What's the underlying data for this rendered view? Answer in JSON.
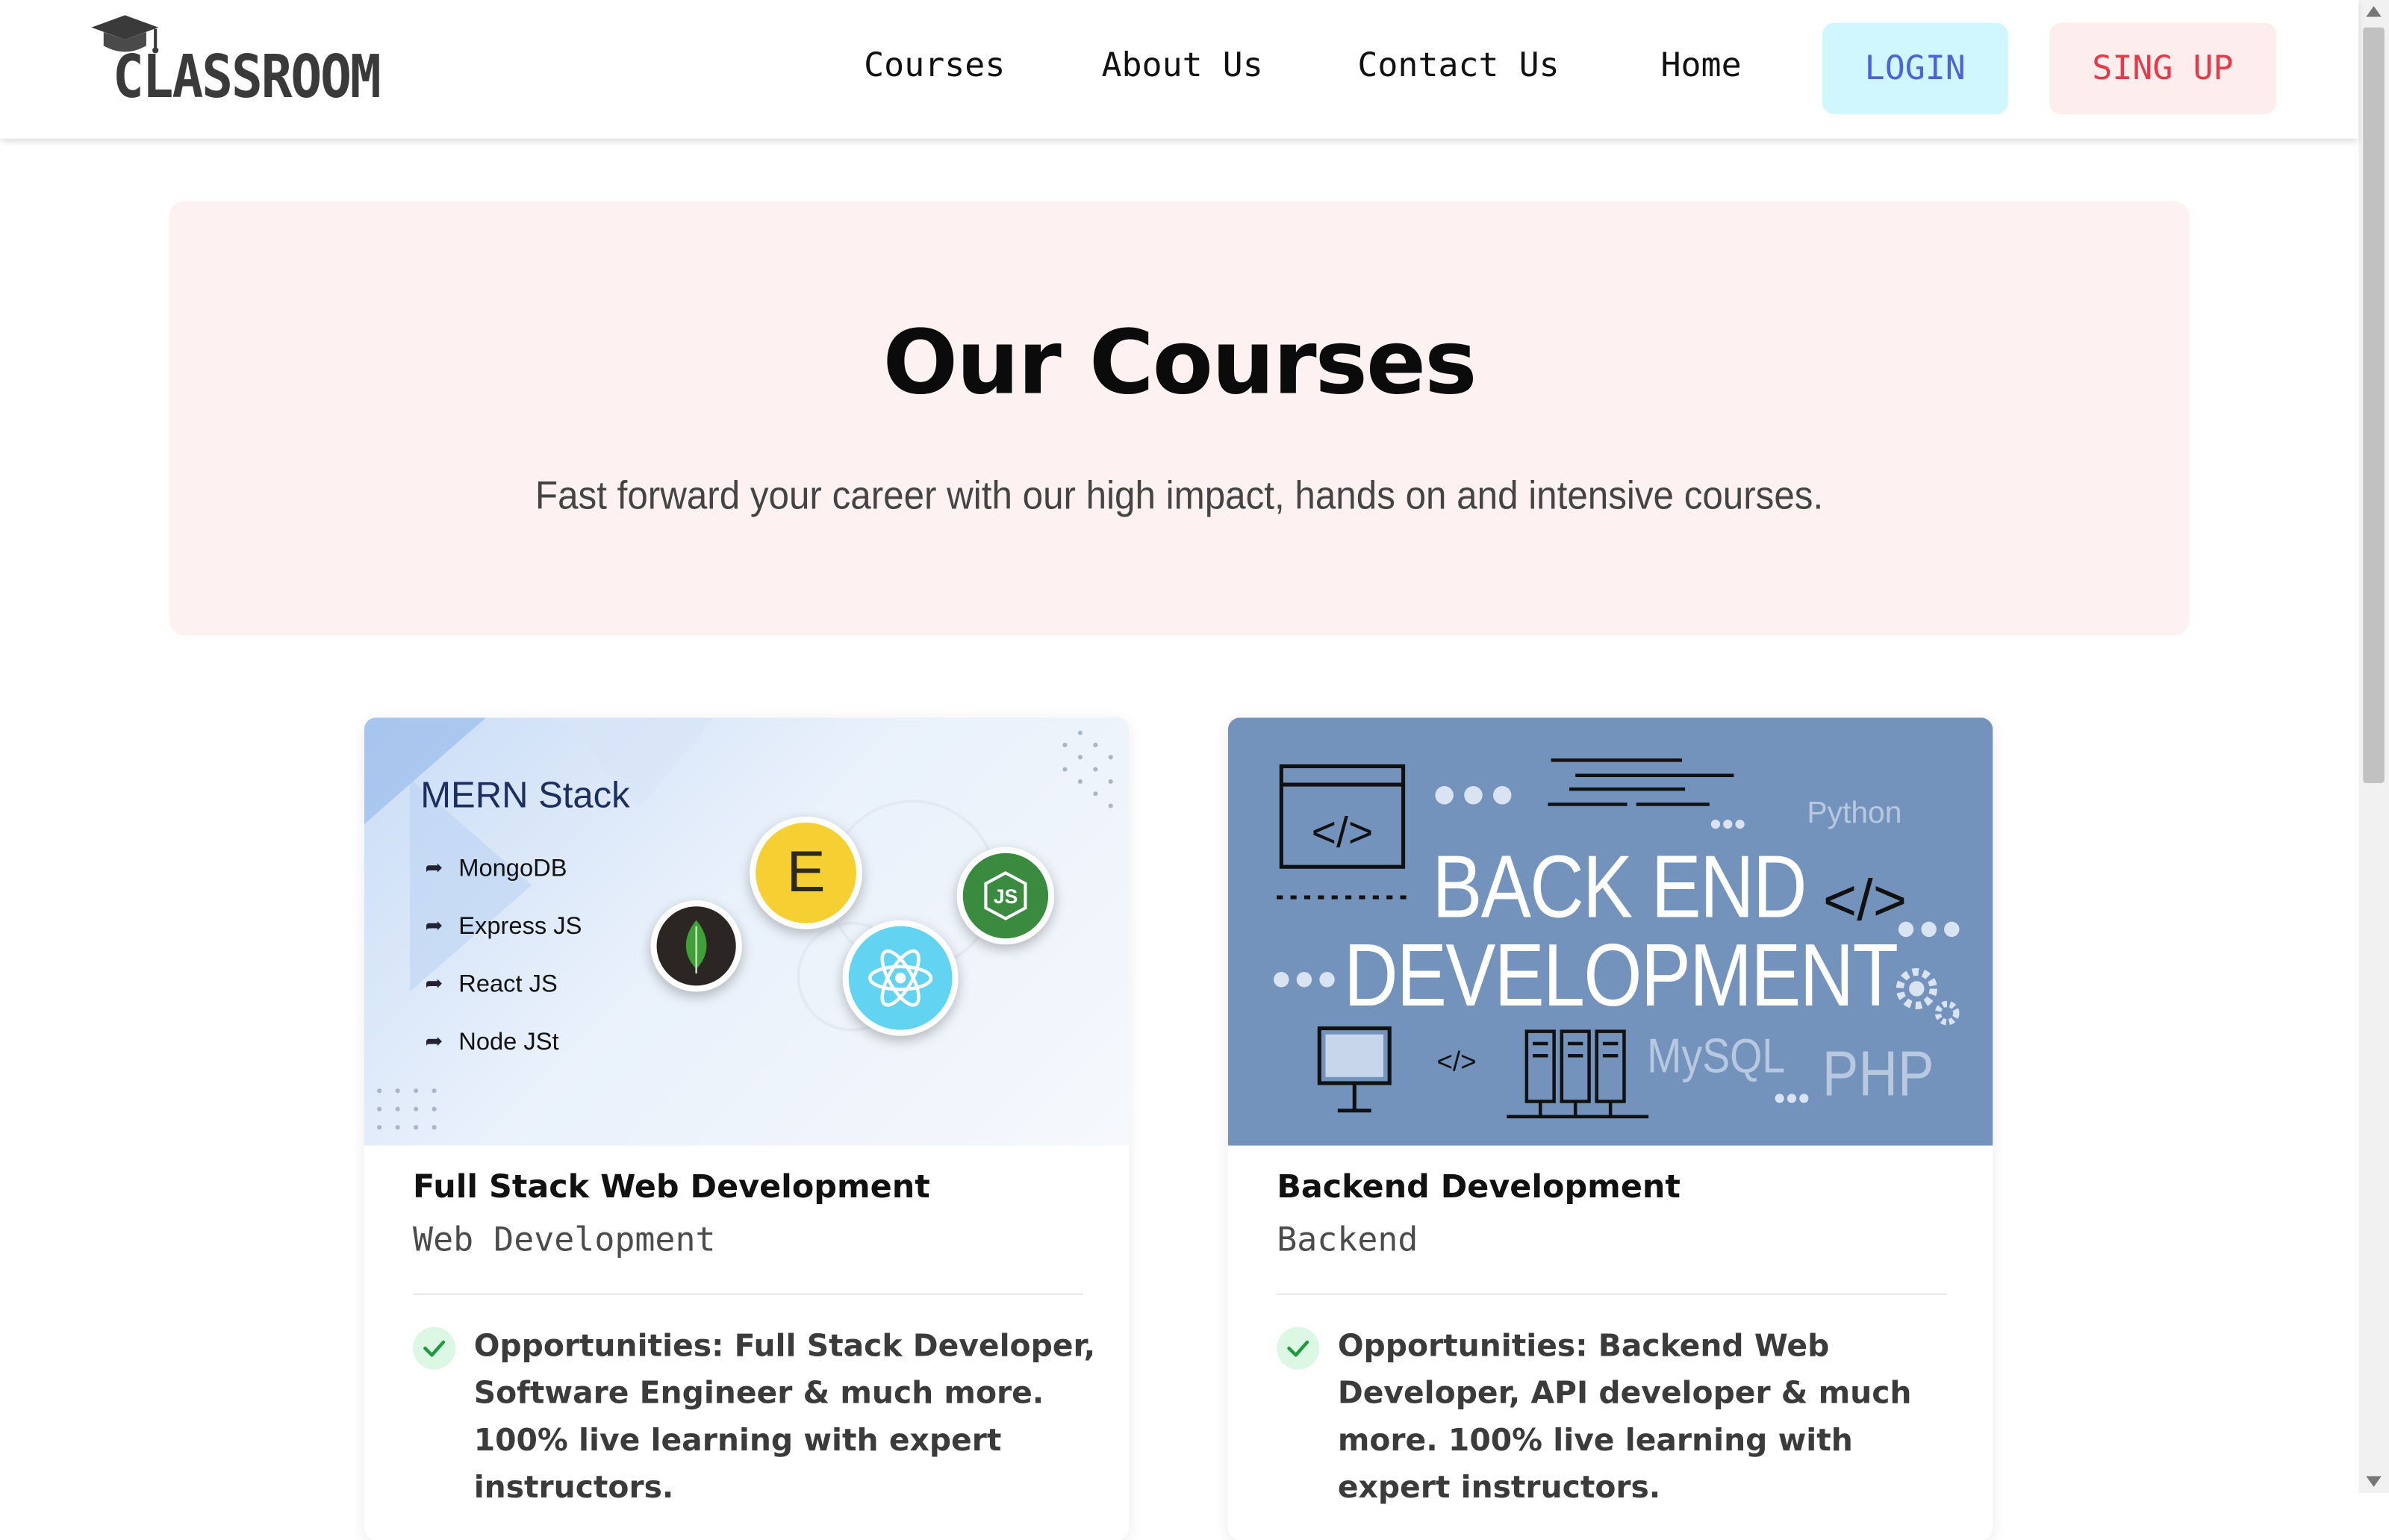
{
  "brand": {
    "logo_text": "CLASSROOM"
  },
  "nav": {
    "links": [
      "Courses",
      "About Us",
      "Contact Us",
      "Home"
    ],
    "login": "LOGIN",
    "signup": "SING UP"
  },
  "hero": {
    "title": "Our Courses",
    "subtitle": "Fast forward your career with our high impact, hands on and intensive courses."
  },
  "courses": [
    {
      "title": "Full Stack Web Development",
      "category": "Web Development",
      "description": "Opportunities: Full Stack Developer, Software Engineer & much more. 100% live learning with expert instructors.",
      "image": {
        "heading": "MERN Stack",
        "items": [
          "MongoDB",
          "Express JS",
          "React JS",
          "Node JSt"
        ],
        "badge_e": "E",
        "badge_js": "JS"
      }
    },
    {
      "title": "Backend Development",
      "category": "Backend",
      "description": "Opportunities: Backend Web Developer, API developer & much more. 100% live learning with expert instructors.",
      "image": {
        "line1": "BACK END",
        "line2": "DEVELOPMENT",
        "code_tag": "</>",
        "small_code_tag": "</>",
        "python": "Python",
        "mysql": "MySQL",
        "php": "PHP"
      }
    }
  ],
  "colors": {
    "login_bg": "#cff7fd",
    "login_text": "#4f63d8",
    "signup_bg": "#fdeded",
    "signup_text": "#e53a49",
    "hero_bg": "#fdf1f1",
    "backend_bg": "#7393bc"
  }
}
